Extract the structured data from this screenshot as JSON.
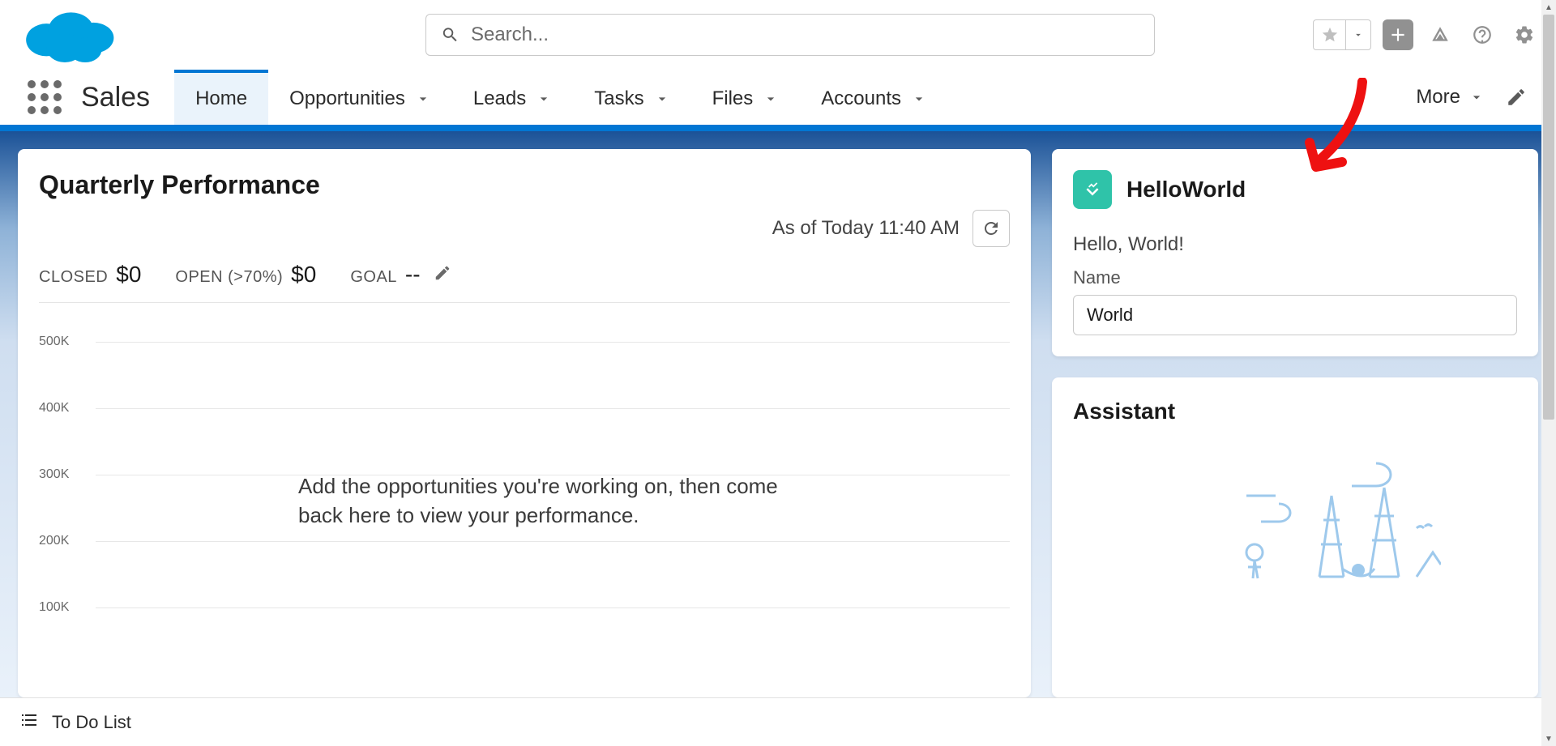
{
  "header": {
    "search_placeholder": "Search..."
  },
  "nav": {
    "app_name": "Sales",
    "items": [
      "Home",
      "Opportunities",
      "Leads",
      "Tasks",
      "Files",
      "Accounts"
    ],
    "more_label": "More"
  },
  "quarterly": {
    "title": "Quarterly Performance",
    "as_of": "As of Today 11:40 AM",
    "metrics": {
      "closed_label": "CLOSED",
      "closed_value": "$0",
      "open_label": "OPEN (>70%)",
      "open_value": "$0",
      "goal_label": "GOAL",
      "goal_value": "--"
    },
    "empty_msg": "Add the opportunities you're working on, then come back here to view your performance."
  },
  "chart_data": {
    "type": "bar",
    "categories": [],
    "values": [],
    "title": "Quarterly Performance",
    "xlabel": "",
    "ylabel": "",
    "ylim": [
      0,
      500000
    ],
    "y_ticks": [
      100000,
      200000,
      300000,
      400000,
      500000
    ],
    "y_tick_labels": [
      "100K",
      "200K",
      "300K",
      "400K",
      "500K"
    ]
  },
  "hello": {
    "title": "HelloWorld",
    "greeting": "Hello, World!",
    "field_label": "Name",
    "field_value": "World"
  },
  "assistant": {
    "title": "Assistant"
  },
  "footer": {
    "todo_label": "To Do List"
  }
}
